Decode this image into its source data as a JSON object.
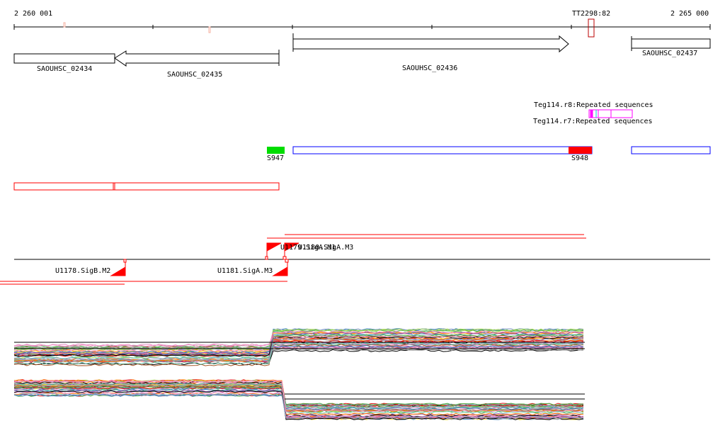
{
  "ruler": {
    "start_label": "2 260 001",
    "end_label": "2 265 000",
    "terminator_label": "TT2298:82"
  },
  "genes": [
    {
      "name": "SAOUHSC_02434",
      "strand": "+"
    },
    {
      "name": "SAOUHSC_02435",
      "strand": "-"
    },
    {
      "name": "SAOUHSC_02436",
      "strand": "+"
    },
    {
      "name": "SAOUHSC_02437",
      "strand": "+"
    }
  ],
  "repeats": {
    "top_label": "Teg114.r8:Repeated sequences",
    "overlap_label": "Teg114.r7:Repeated sequences"
  },
  "segments": [
    {
      "name": "S947",
      "color": "#00dd00"
    },
    {
      "name": "S948",
      "color": "#ff0000"
    }
  ],
  "promoters": [
    {
      "name": "U1178.SigB.M2"
    },
    {
      "name": "U1181.SigA.M3"
    },
    {
      "name": "U1179.SigA.M1"
    },
    {
      "name": "U1180.SigA.M3"
    }
  ],
  "colors": {
    "accent": "#ff0000",
    "segment_outline": "#0000ff",
    "repeat": "#ff00ff"
  }
}
